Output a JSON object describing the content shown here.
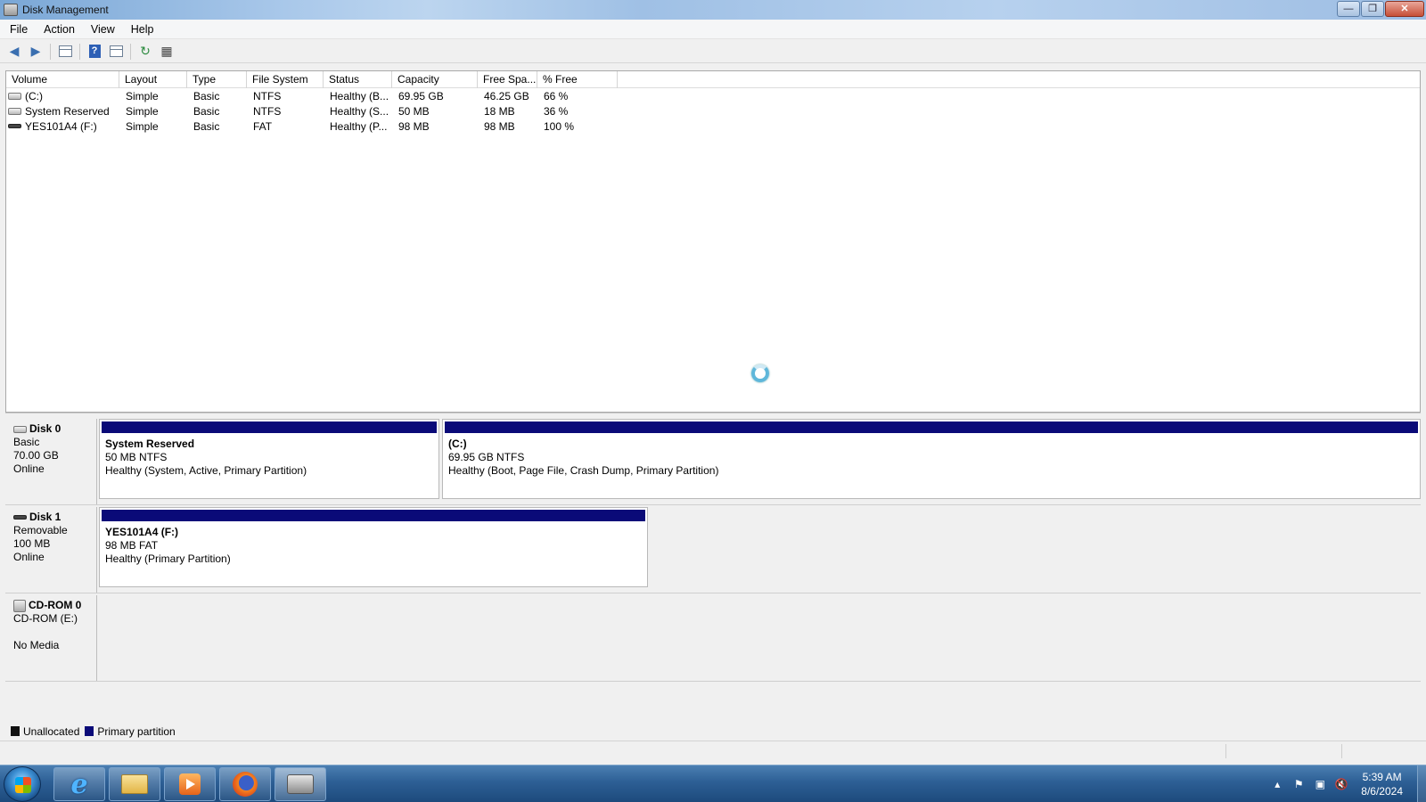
{
  "window": {
    "title": "Disk Management",
    "buttons": {
      "minimize": "—",
      "maximize": "❐",
      "close": "✕"
    }
  },
  "menu": [
    "File",
    "Action",
    "View",
    "Help"
  ],
  "toolbar": {
    "icons": [
      "back-arrow-icon",
      "forward-arrow-icon",
      "console-tree-icon",
      "help-icon",
      "properties-icon",
      "refresh-icon",
      "export-list-icon"
    ]
  },
  "volume_list": {
    "columns": [
      "Volume",
      "Layout",
      "Type",
      "File System",
      "Status",
      "Capacity",
      "Free Spa...",
      "% Free"
    ],
    "rows": [
      {
        "volume": "(C:)",
        "layout": "Simple",
        "type": "Basic",
        "fs": "NTFS",
        "status": "Healthy (B...",
        "capacity": "69.95 GB",
        "free": "46.25 GB",
        "pct": "66 %",
        "icon": "hard-drive-icon"
      },
      {
        "volume": "System Reserved",
        "layout": "Simple",
        "type": "Basic",
        "fs": "NTFS",
        "status": "Healthy (S...",
        "capacity": "50 MB",
        "free": "18 MB",
        "pct": "36 %",
        "icon": "hard-drive-icon"
      },
      {
        "volume": "YES101A4 (F:)",
        "layout": "Simple",
        "type": "Basic",
        "fs": "FAT",
        "status": "Healthy (P...",
        "capacity": "98 MB",
        "free": "98 MB",
        "pct": "100 %",
        "icon": "usb-drive-icon"
      }
    ]
  },
  "disks": [
    {
      "name": "Disk 0",
      "line1": "Basic",
      "line2": "70.00 GB",
      "line3": "Online",
      "partitions": [
        {
          "name": "System Reserved",
          "size": "50 MB NTFS",
          "status": "Healthy (System, Active, Primary Partition)"
        },
        {
          "name": "(C:)",
          "size": "69.95 GB NTFS",
          "status": "Healthy (Boot, Page File, Crash Dump, Primary Partition)"
        }
      ]
    },
    {
      "name": "Disk 1",
      "line1": "Removable",
      "line2": "100 MB",
      "line3": "Online",
      "partitions": [
        {
          "name": "YES101A4  (F:)",
          "size": "98 MB FAT",
          "status": "Healthy (Primary Partition)"
        }
      ]
    },
    {
      "name": "CD-ROM 0",
      "line1": "CD-ROM (E:)",
      "line2": "",
      "line3": "No Media",
      "partitions": []
    }
  ],
  "legend": [
    {
      "label": "Unallocated",
      "color": "#111111"
    },
    {
      "label": "Primary partition",
      "color": "#0a0a78"
    }
  ],
  "taskbar": {
    "apps": [
      "internet-explorer-icon",
      "file-explorer-icon",
      "media-player-icon",
      "firefox-icon",
      "disk-management-icon"
    ],
    "clock_time": "5:39 AM",
    "clock_date": "8/6/2024"
  }
}
